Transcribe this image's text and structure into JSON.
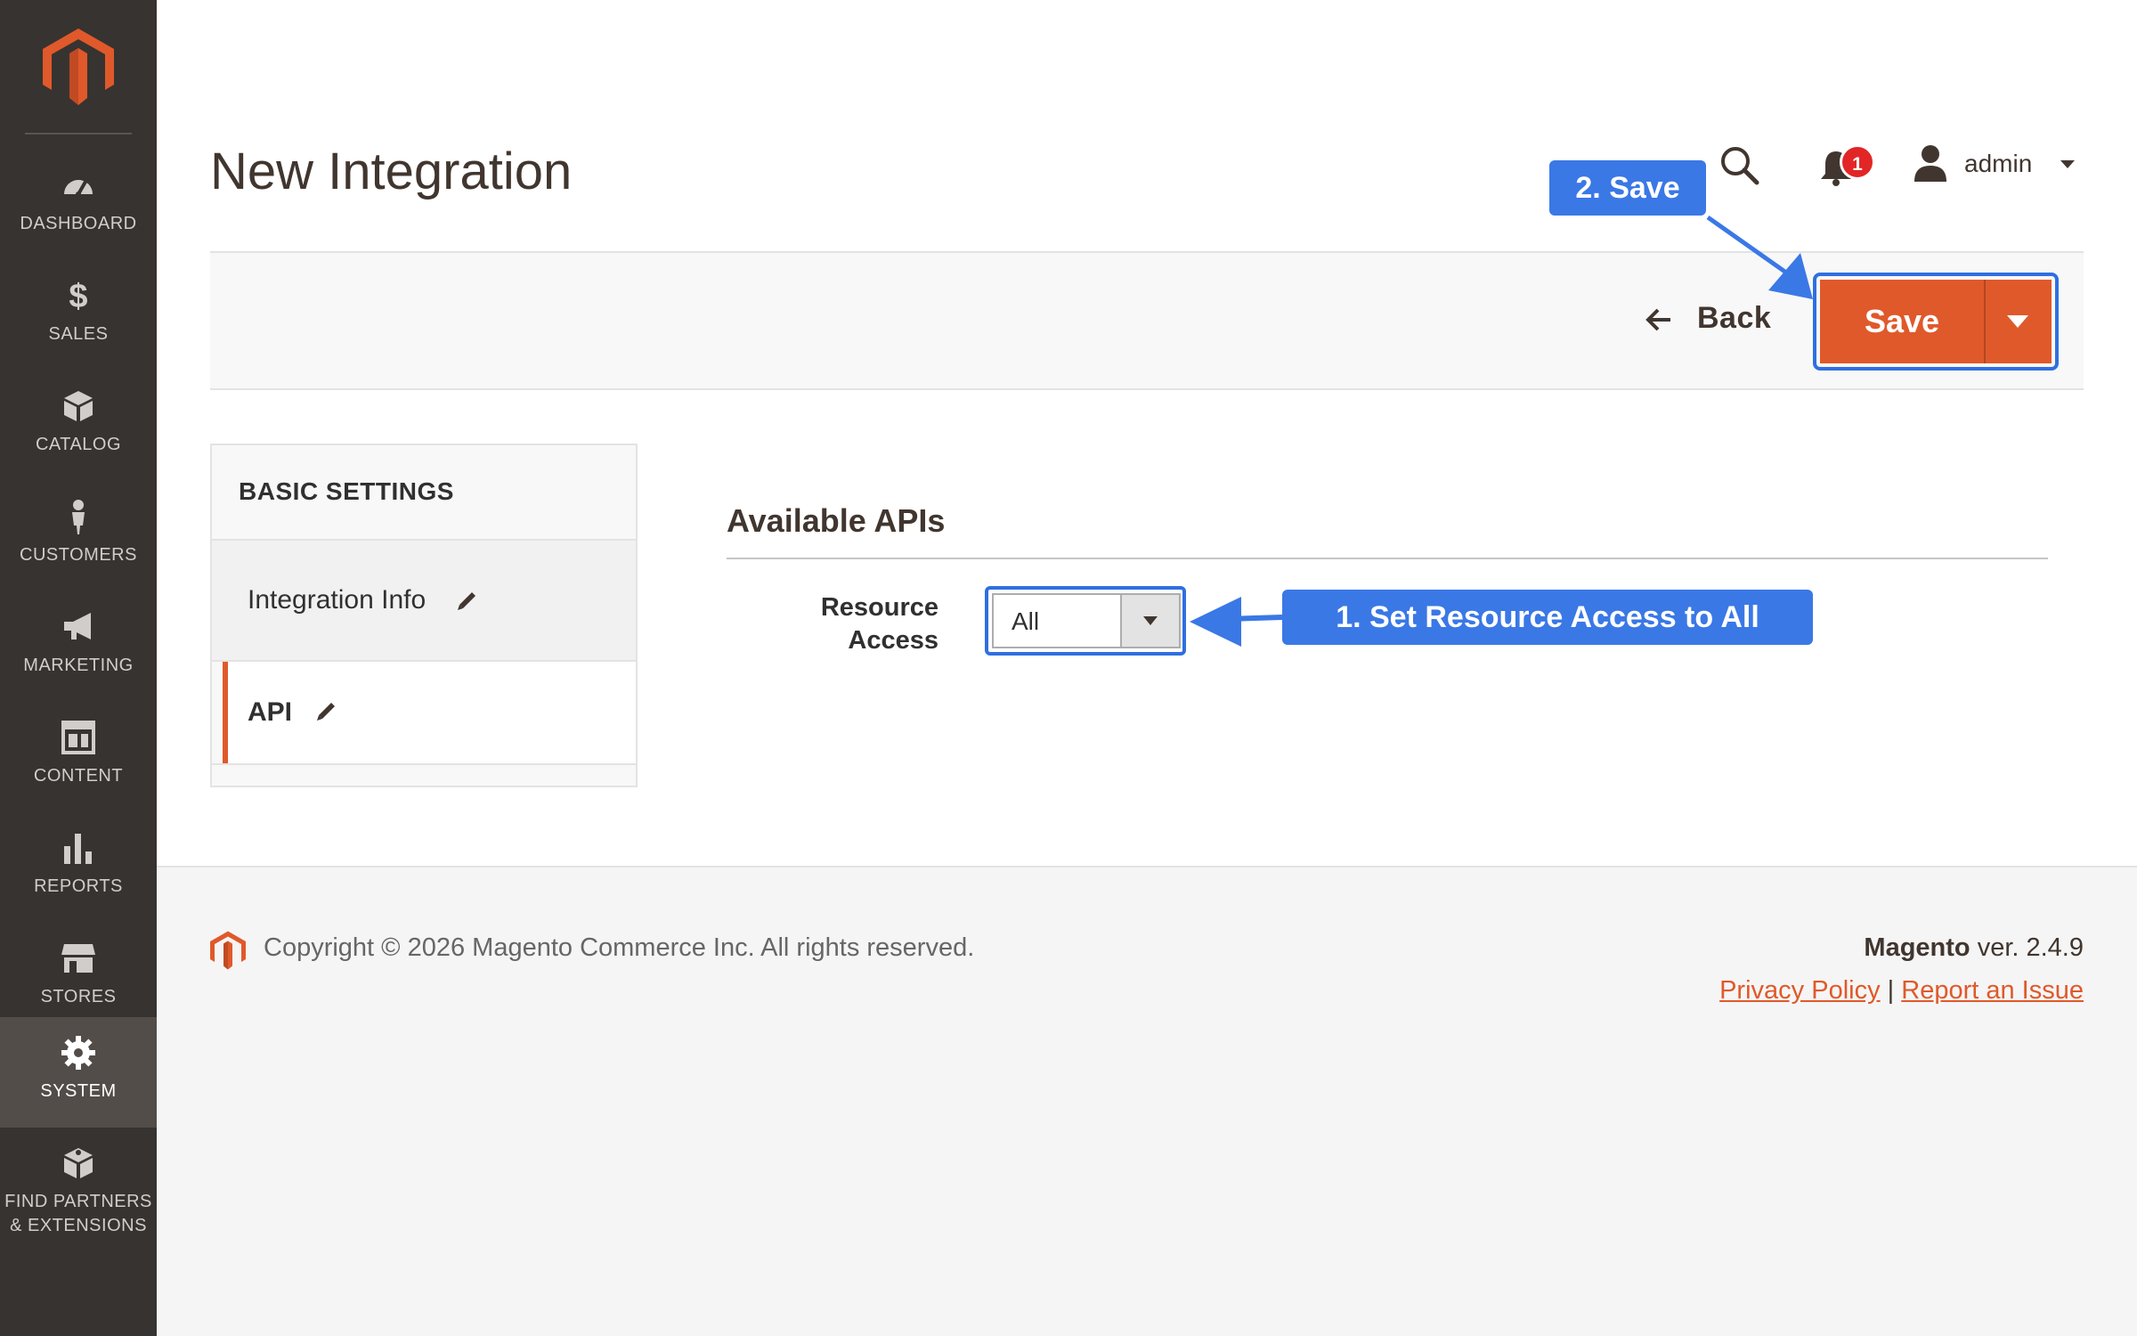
{
  "sidebar": {
    "items": [
      {
        "label": "DASHBOARD",
        "icon": "dashboard-icon"
      },
      {
        "label": "SALES",
        "icon": "dollar-icon"
      },
      {
        "label": "CATALOG",
        "icon": "box-icon"
      },
      {
        "label": "CUSTOMERS",
        "icon": "person-icon"
      },
      {
        "label": "MARKETING",
        "icon": "megaphone-icon"
      },
      {
        "label": "CONTENT",
        "icon": "layout-icon"
      },
      {
        "label": "REPORTS",
        "icon": "bar-chart-icon"
      },
      {
        "label": "STORES",
        "icon": "storefront-icon"
      },
      {
        "label": "SYSTEM",
        "icon": "gear-icon"
      },
      {
        "label_line1": "FIND PARTNERS",
        "label_line2": "& EXTENSIONS",
        "icon": "extensions-icon"
      }
    ],
    "active": "SYSTEM"
  },
  "header": {
    "title": "New Integration",
    "notification_count": "1",
    "user": "admin"
  },
  "actions": {
    "back_label": "Back",
    "save_label": "Save"
  },
  "tabs": {
    "title": "BASIC SETTINGS",
    "items": [
      {
        "label": "Integration Info"
      },
      {
        "label": "API"
      }
    ],
    "active": "API"
  },
  "content": {
    "section_title": "Available APIs",
    "field_label_line1": "Resource",
    "field_label_line2": "Access",
    "field_value": "All"
  },
  "annotations": {
    "step1": "1. Set Resource Access to All",
    "step2": "2. Save"
  },
  "footer": {
    "copyright": "Copyright © 2026 Magento Commerce Inc. All rights reserved.",
    "brand": "Magento",
    "version": " ver. 2.4.9",
    "privacy": "Privacy Policy",
    "separator": "|",
    "report": "Report an Issue"
  },
  "colors": {
    "accent": "#e0592a",
    "sidebar_bg": "#373330",
    "annotation_blue": "#3a78e6"
  }
}
